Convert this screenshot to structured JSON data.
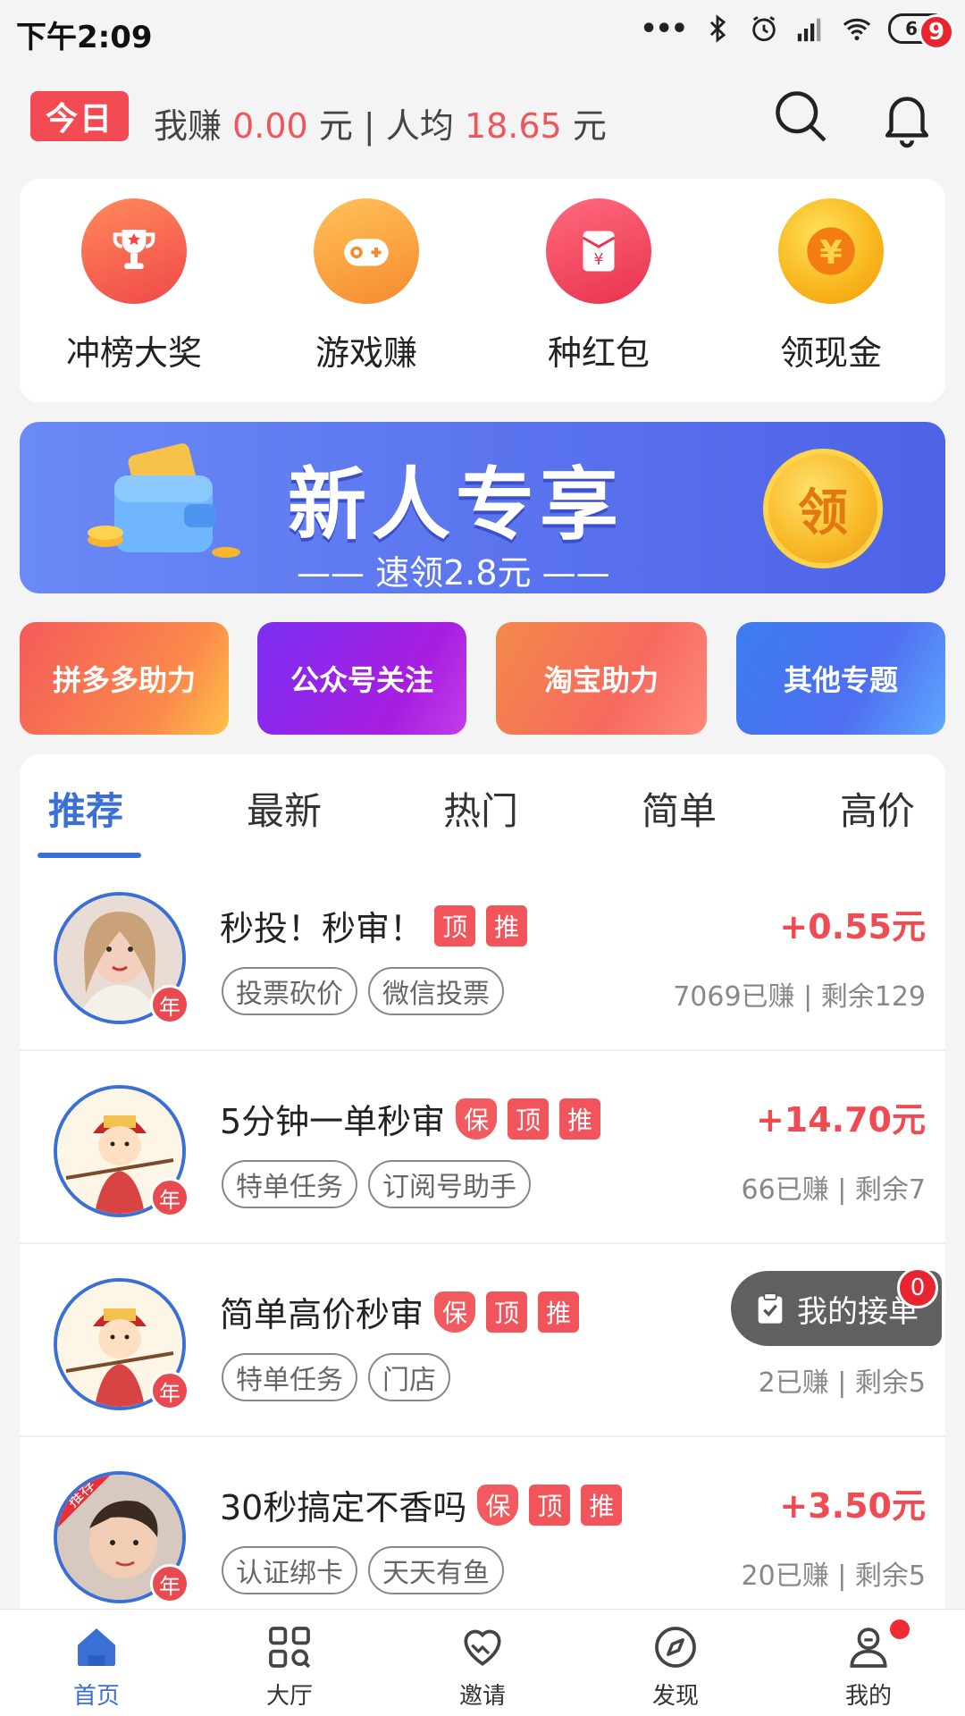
{
  "status_bar": {
    "time": "下午2:09",
    "dots": "•••",
    "battery": "64"
  },
  "header": {
    "today_badge": "今日",
    "earn_prefix": "我赚",
    "my_earn": "0.00",
    "unit": "元",
    "separator": "|",
    "avg_prefix": "人均",
    "avg_earn": "18.65",
    "notification_count": "9"
  },
  "quick_actions": [
    {
      "label": "冲榜大奖",
      "icon": "trophy-icon",
      "color": "#f5594f"
    },
    {
      "label": "游戏赚",
      "icon": "gamepad-icon",
      "color": "#f8a23a"
    },
    {
      "label": "种红包",
      "icon": "red-envelope-icon",
      "color": "#f04a63"
    },
    {
      "label": "领现金",
      "icon": "yuan-coin-icon",
      "color": "#f6a623"
    }
  ],
  "banner": {
    "title": "新人专享",
    "subtitle": "—— 速领2.8元 ——",
    "coin_label": "领"
  },
  "topics": [
    {
      "label": "拼多多助力"
    },
    {
      "label": "公众号关注"
    },
    {
      "label": "淘宝助力"
    },
    {
      "label": "其他专题"
    }
  ],
  "tabs": [
    {
      "label": "推荐",
      "active": true
    },
    {
      "label": "最新",
      "active": false
    },
    {
      "label": "热门",
      "active": false
    },
    {
      "label": "简单",
      "active": false
    },
    {
      "label": "高价",
      "active": false
    }
  ],
  "year_badge": "年",
  "tasks": [
    {
      "title": "秒投！秒审！",
      "flags": [
        "顶",
        "推"
      ],
      "tags": [
        "投票砍价",
        "微信投票"
      ],
      "price": "+0.55元",
      "stats": "7069已赚 | 剩余129"
    },
    {
      "title": "5分钟一单秒审",
      "flags": [
        "保",
        "顶",
        "推"
      ],
      "tags": [
        "特单任务",
        "订阅号助手"
      ],
      "price": "+14.70元",
      "stats": "66已赚 | 剩余7"
    },
    {
      "title": "简单高价秒审",
      "flags": [
        "保",
        "顶",
        "推"
      ],
      "tags": [
        "特单任务",
        "门店"
      ],
      "price": "",
      "stats": "2已赚 | 剩余5"
    },
    {
      "title": "30秒搞定不香吗",
      "flags": [
        "保",
        "顶",
        "推"
      ],
      "tags": [
        "认证绑卡",
        "天天有鱼"
      ],
      "price": "+3.50元",
      "stats": "20已赚 | 剩余5",
      "corner_ribbon": "推荐"
    }
  ],
  "float_orders": {
    "label": "我的接单",
    "count": "0"
  },
  "bottom_nav": [
    {
      "label": "首页",
      "icon": "home-icon",
      "active": true
    },
    {
      "label": "大厅",
      "icon": "grid-search-icon",
      "active": false
    },
    {
      "label": "邀请",
      "icon": "handshake-heart-icon",
      "active": false
    },
    {
      "label": "发现",
      "icon": "compass-icon",
      "active": false
    },
    {
      "label": "我的",
      "icon": "user-icon",
      "active": false
    }
  ],
  "colors": {
    "accent_blue": "#3a6fd6",
    "accent_red": "#f2545b",
    "banner_blue": "#5a73ee"
  }
}
